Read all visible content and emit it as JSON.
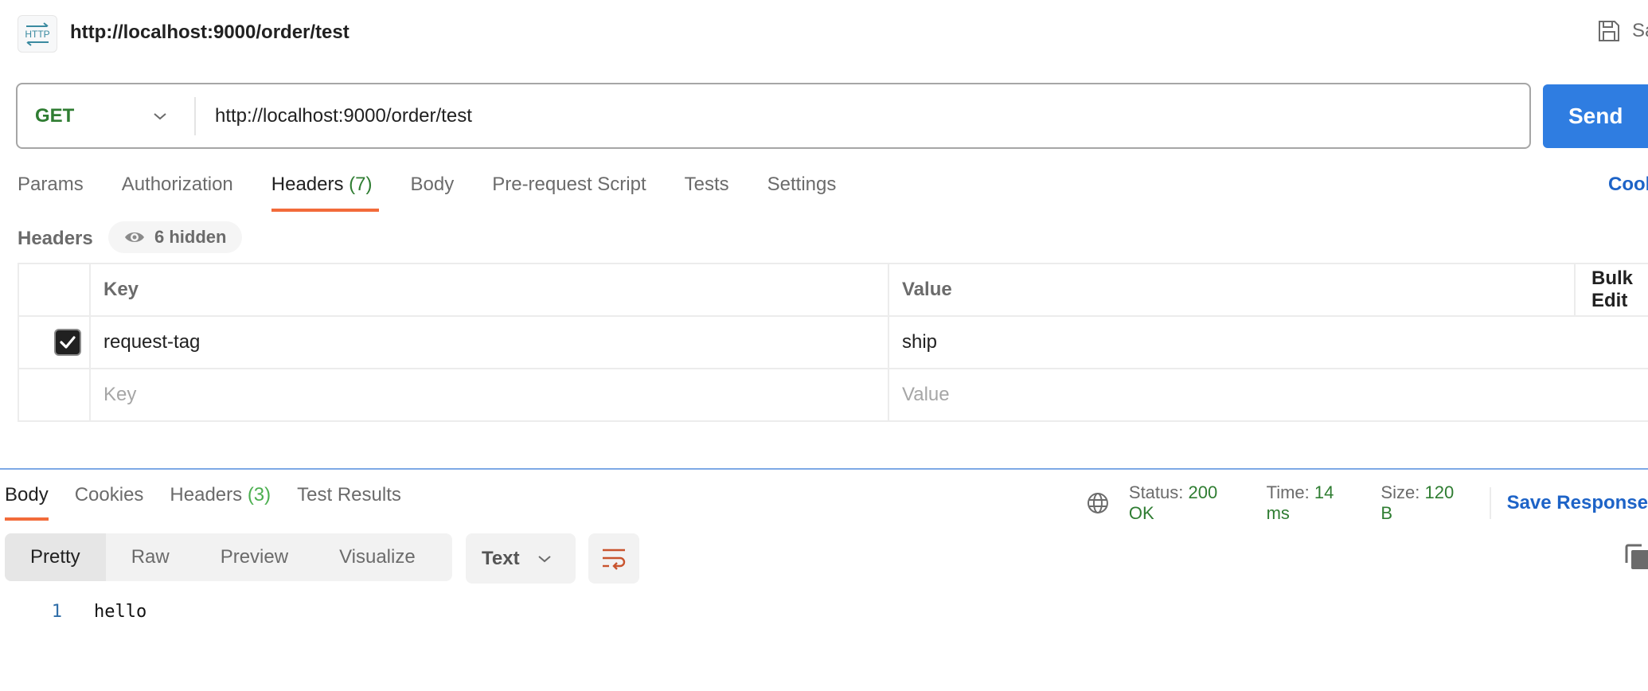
{
  "header": {
    "icon": "http-icon",
    "icon_text": "HTTP",
    "title": "http://localhost:9000/order/test",
    "save_label": "Save"
  },
  "request": {
    "method": "GET",
    "url": "http://localhost:9000/order/test",
    "send_label": "Send",
    "method_color": "#2f7d32",
    "send_color": "#2f7de1"
  },
  "request_tabs": [
    {
      "label": "Params",
      "count": "",
      "active": false
    },
    {
      "label": "Authorization",
      "count": "",
      "active": false
    },
    {
      "label": "Headers",
      "count": "(7)",
      "active": true
    },
    {
      "label": "Body",
      "count": "",
      "active": false
    },
    {
      "label": "Pre-request Script",
      "count": "",
      "active": false
    },
    {
      "label": "Tests",
      "count": "",
      "active": false
    },
    {
      "label": "Settings",
      "count": "",
      "active": false
    }
  ],
  "cookies_link": "Cookies",
  "headers_section": {
    "label": "Headers",
    "hidden_label": "6 hidden",
    "columns": {
      "key": "Key",
      "value": "Value",
      "bulk_edit": "Bulk Edit"
    },
    "rows": [
      {
        "checked": true,
        "key": "request-tag",
        "value": "ship"
      }
    ],
    "new_row": {
      "key_placeholder": "Key",
      "value_placeholder": "Value"
    }
  },
  "response_tabs": [
    {
      "label": "Body",
      "count": "",
      "active": true
    },
    {
      "label": "Cookies",
      "count": "",
      "active": false
    },
    {
      "label": "Headers",
      "count": "(3)",
      "active": false
    },
    {
      "label": "Test Results",
      "count": "",
      "active": false
    }
  ],
  "response_meta": {
    "status_label": "Status:",
    "status_value": "200 OK",
    "time_label": "Time:",
    "time_value": "14 ms",
    "size_label": "Size:",
    "size_value": "120 B",
    "save_response_label": "Save Response"
  },
  "response_view": {
    "modes": [
      "Pretty",
      "Raw",
      "Preview",
      "Visualize"
    ],
    "active_mode": "Pretty",
    "format": "Text"
  },
  "response_body": [
    {
      "line": "1",
      "text": "hello"
    }
  ],
  "colors": {
    "accent_tab": "#f26b3a",
    "link": "#1d63c7",
    "success": "#2f7d32"
  }
}
